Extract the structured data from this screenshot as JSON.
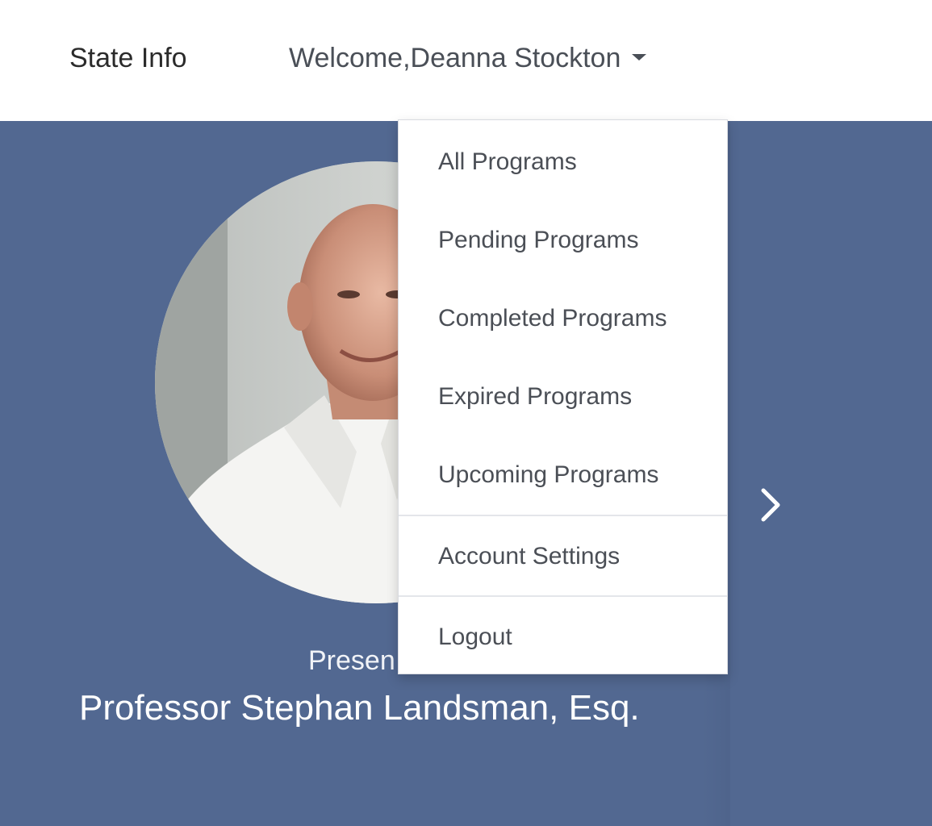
{
  "navbar": {
    "state_info_label": "State Info",
    "welcome_label": "Welcome,Deanna Stockton"
  },
  "dropdown": {
    "items": [
      {
        "label": "All Programs"
      },
      {
        "label": "Pending Programs"
      },
      {
        "label": "Completed Programs"
      },
      {
        "label": "Expired Programs"
      },
      {
        "label": "Upcoming Programs"
      }
    ],
    "account_settings_label": "Account Settings",
    "logout_label": "Logout"
  },
  "hero": {
    "presenter_label": "Presen",
    "presenter_name": "Professor Stephan Landsman, Esq."
  },
  "colors": {
    "hero_background": "#526891",
    "dropdown_text": "#4b4f56",
    "navbar_background": "#ffffff"
  },
  "icons": {
    "dropdown_caret": "caret-down-icon",
    "carousel_next": "chevron-right-icon"
  }
}
